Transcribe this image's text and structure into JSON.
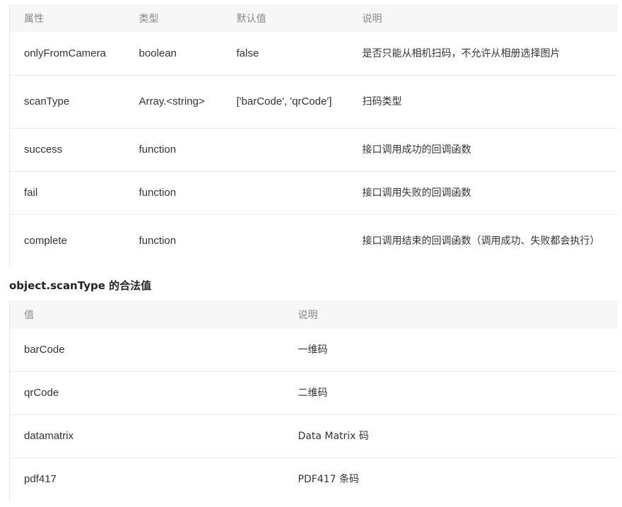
{
  "params_table": {
    "headers": [
      "属性",
      "类型",
      "默认值",
      "说明"
    ],
    "rows": [
      {
        "name": "onlyFromCamera",
        "type": "boolean",
        "default": "false",
        "desc": "是否只能从相机扫码，不允许从相册选择图片"
      },
      {
        "name": "scanType",
        "type": "Array.<string>",
        "default": "['barCode', 'qrCode']",
        "desc": "扫码类型"
      },
      {
        "name": "success",
        "type": "function",
        "default": "",
        "desc": "接口调用成功的回调函数"
      },
      {
        "name": "fail",
        "type": "function",
        "default": "",
        "desc": "接口调用失败的回调函数"
      },
      {
        "name": "complete",
        "type": "function",
        "default": "",
        "desc": "接口调用结束的回调函数（调用成功、失败都会执行）"
      }
    ]
  },
  "scan_type_section": {
    "heading": "object.scanType 的合法值",
    "headers": [
      "值",
      "说明"
    ],
    "rows": [
      {
        "value": "barCode",
        "desc": "一维码"
      },
      {
        "value": "qrCode",
        "desc": "二维码"
      },
      {
        "value": "datamatrix",
        "desc": "Data Matrix 码"
      },
      {
        "value": "pdf417",
        "desc": "PDF417 条码"
      }
    ]
  }
}
